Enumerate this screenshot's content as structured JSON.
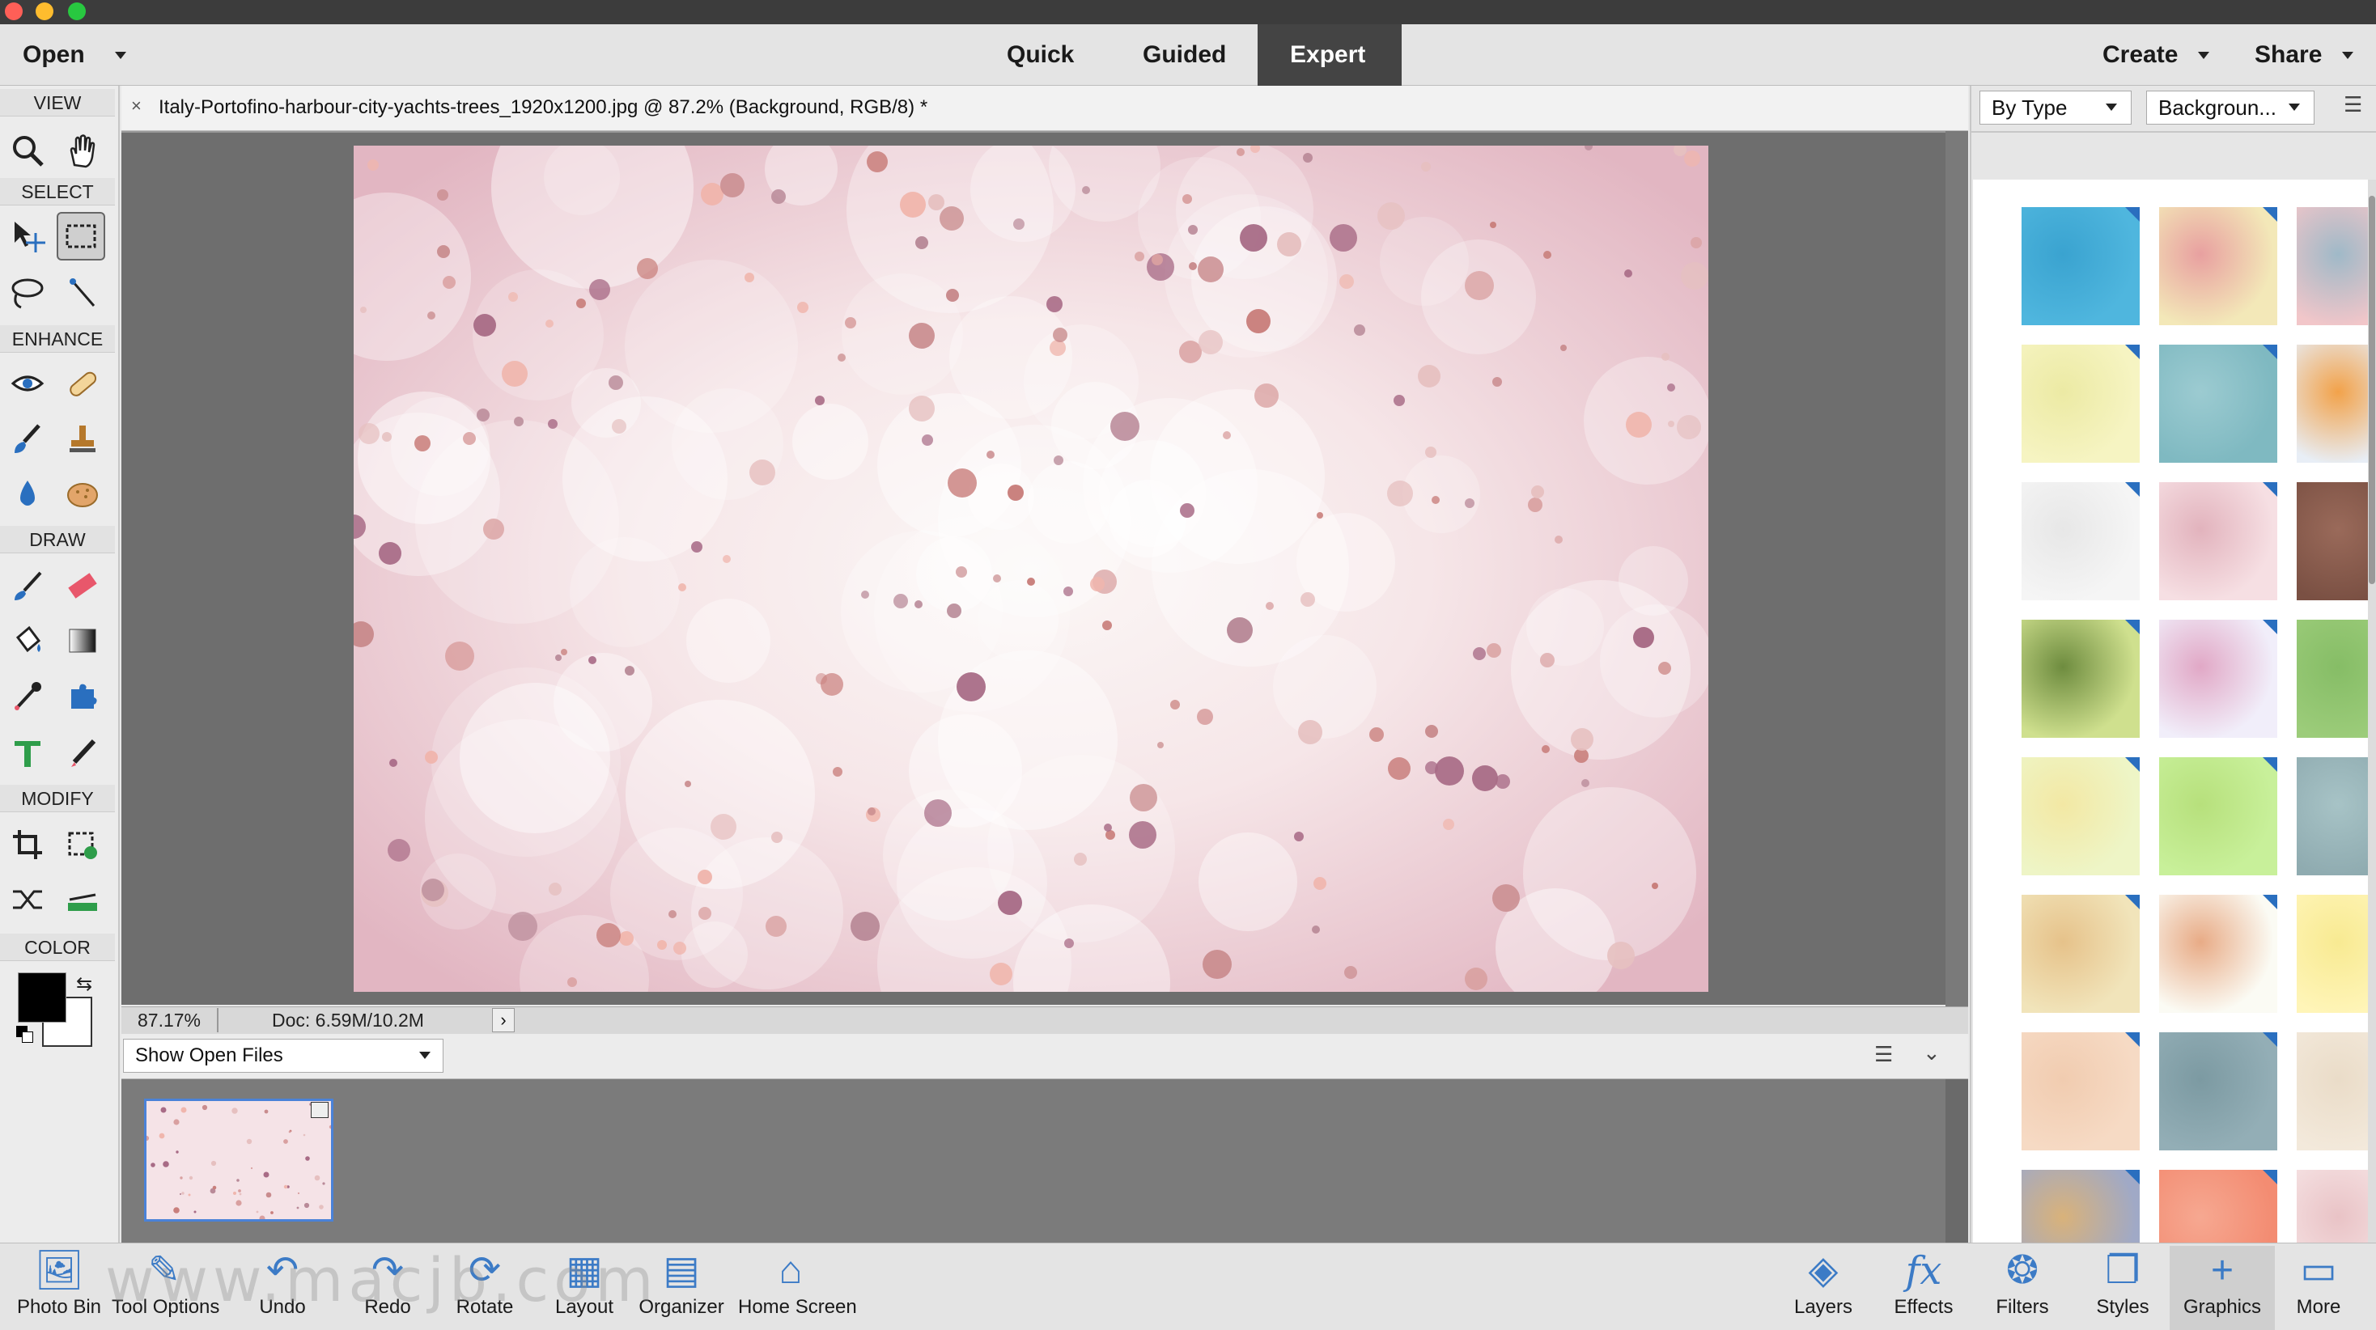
{
  "menu": {
    "open_label": "Open",
    "modes": [
      "Quick",
      "Guided",
      "Expert"
    ],
    "active_mode": "Expert",
    "create_label": "Create",
    "share_label": "Share"
  },
  "toolbox": {
    "sections": [
      "VIEW",
      "SELECT",
      "ENHANCE",
      "DRAW",
      "MODIFY",
      "COLOR"
    ],
    "tools": [
      {
        "name": "zoom-tool",
        "icon": "magnifier-icon"
      },
      {
        "name": "hand-tool",
        "icon": "hand-icon"
      },
      {
        "name": "move-tool",
        "icon": "move-arrows-icon"
      },
      {
        "name": "rectangular-marquee-tool",
        "icon": "marquee-icon"
      },
      {
        "name": "lasso-tool",
        "icon": "lasso-icon"
      },
      {
        "name": "quick-selection-tool",
        "icon": "magic-wand-icon"
      },
      {
        "name": "red-eye-tool",
        "icon": "eye-icon"
      },
      {
        "name": "spot-healing-tool",
        "icon": "bandage-icon"
      },
      {
        "name": "smart-brush-tool",
        "icon": "smart-brush-icon"
      },
      {
        "name": "clone-stamp-tool",
        "icon": "stamp-icon"
      },
      {
        "name": "blur-tool",
        "icon": "drop-icon"
      },
      {
        "name": "sponge-tool",
        "icon": "sponge-icon"
      },
      {
        "name": "brush-tool",
        "icon": "brush-icon"
      },
      {
        "name": "eraser-tool",
        "icon": "eraser-icon"
      },
      {
        "name": "paint-bucket-tool",
        "icon": "bucket-icon"
      },
      {
        "name": "gradient-tool",
        "icon": "gradient-icon"
      },
      {
        "name": "eyedropper-tool",
        "icon": "eyedropper-icon"
      },
      {
        "name": "custom-shape-tool",
        "icon": "puzzle-icon"
      },
      {
        "name": "type-tool",
        "icon": "type-icon"
      },
      {
        "name": "pencil-tool",
        "icon": "pencil-icon"
      },
      {
        "name": "crop-tool",
        "icon": "crop-icon"
      },
      {
        "name": "recompose-tool",
        "icon": "recompose-icon"
      },
      {
        "name": "content-aware-move-tool",
        "icon": "shuffle-icon"
      },
      {
        "name": "straighten-tool",
        "icon": "straighten-icon"
      }
    ],
    "foreground_color": "#000000",
    "background_color": "#ffffff"
  },
  "document": {
    "tab_title": "Italy-Portofino-harbour-city-yachts-trees_1920x1200.jpg @ 87.2% (Background, RGB/8) *",
    "zoom": "87.17%",
    "doc_size": "Doc: 6.59M/10.2M"
  },
  "photo_bin": {
    "show_label": "Show Open Files"
  },
  "graphics_panel": {
    "filter_type": "By Type",
    "filter_category": "Backgroun..."
  },
  "bottombar": {
    "left": [
      {
        "label": "Photo Bin",
        "icon": "photo-bin-icon"
      },
      {
        "label": "Tool Options",
        "icon": "tool-options-icon"
      },
      {
        "label": "Undo",
        "icon": "undo-icon"
      },
      {
        "label": "Redo",
        "icon": "redo-icon"
      },
      {
        "label": "Rotate",
        "icon": "rotate-icon"
      },
      {
        "label": "Layout",
        "icon": "layout-icon"
      },
      {
        "label": "Organizer",
        "icon": "organizer-icon"
      },
      {
        "label": "Home Screen",
        "icon": "home-icon"
      }
    ],
    "right": [
      {
        "label": "Layers",
        "icon": "layers-icon"
      },
      {
        "label": "Effects",
        "icon": "fx-icon"
      },
      {
        "label": "Filters",
        "icon": "filters-icon"
      },
      {
        "label": "Styles",
        "icon": "styles-icon"
      },
      {
        "label": "Graphics",
        "icon": "plus-icon"
      },
      {
        "label": "More",
        "icon": "more-icon"
      }
    ]
  },
  "watermark_text": "www.macjb.com"
}
